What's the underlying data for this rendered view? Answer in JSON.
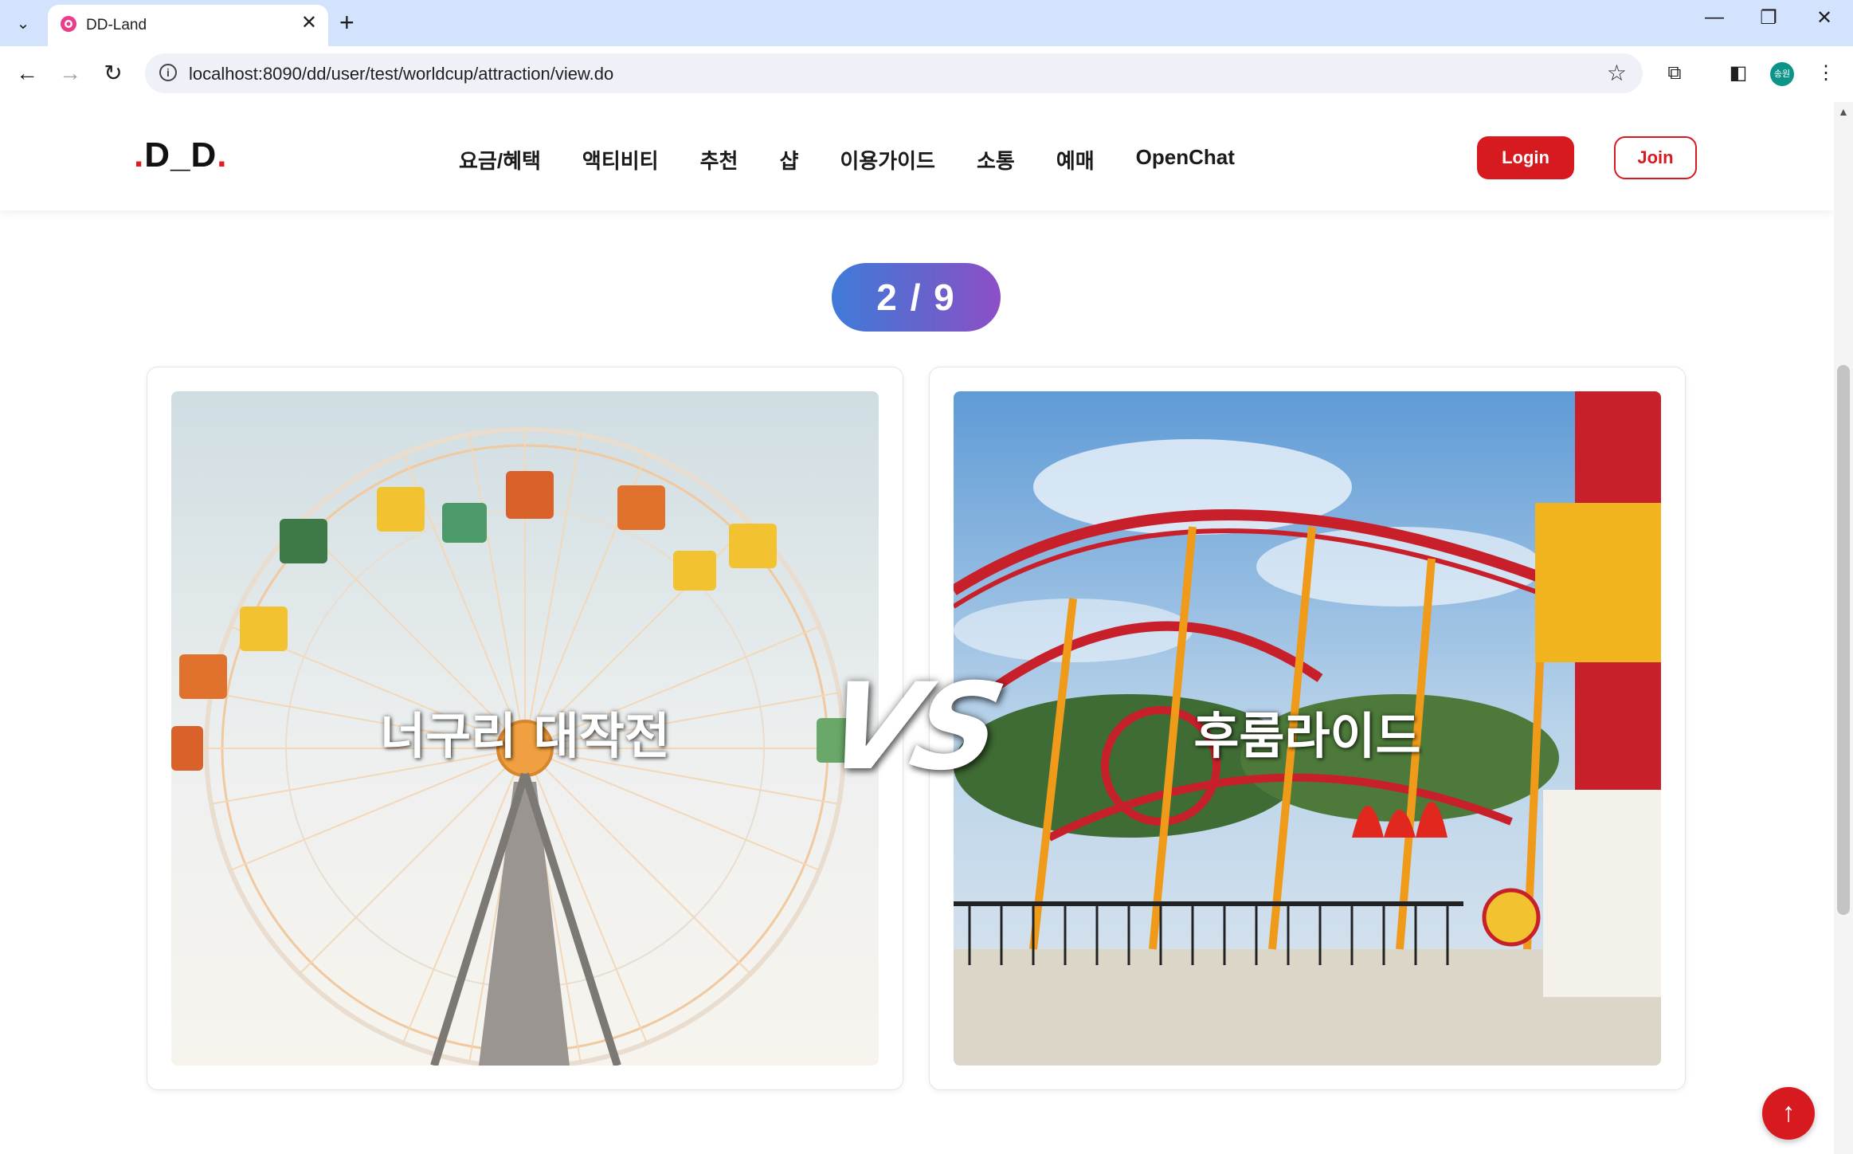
{
  "browser": {
    "tab_title": "DD-Land",
    "url": "localhost:8090/dd/user/test/worldcup/attraction/view.do",
    "profile_initials": "송원"
  },
  "site": {
    "logo": {
      "prefix_dot": ".",
      "text": "D_D",
      "suffix_dot": "."
    },
    "nav": [
      "요금/혜택",
      "액티비티",
      "추천",
      "샵",
      "이용가이드",
      "소통",
      "예매",
      "OpenChat"
    ],
    "login_label": "Login",
    "join_label": "Join"
  },
  "worldcup": {
    "round_text": "2 / 9",
    "vs_text": "VS",
    "left_choice": {
      "name": "너구리 대작전",
      "image": "ferris-wheel"
    },
    "right_choice": {
      "name": "후룸라이드",
      "image": "roller-coaster"
    }
  },
  "colors": {
    "brand_red": "#d71920",
    "pill_gradient_start": "#3f7bd9",
    "pill_gradient_end": "#8e4ec6",
    "chrome_blue": "#d3e3fd"
  },
  "icons": {
    "scroll_top": "arrow-up-icon"
  }
}
